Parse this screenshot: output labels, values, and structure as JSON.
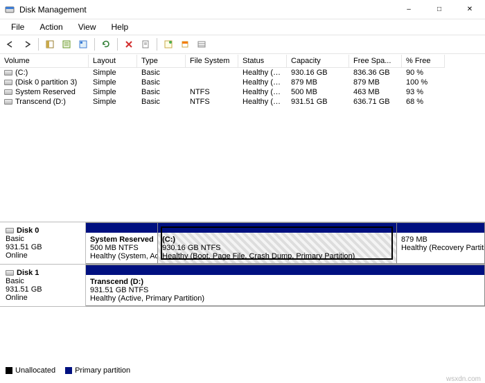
{
  "window": {
    "title": "Disk Management"
  },
  "menu": {
    "file": "File",
    "action": "Action",
    "view": "View",
    "help": "Help"
  },
  "columns": {
    "volume": "Volume",
    "layout": "Layout",
    "type": "Type",
    "filesystem": "File System",
    "status": "Status",
    "capacity": "Capacity",
    "freespace": "Free Spa...",
    "pctfree": "% Free"
  },
  "volumes": [
    {
      "name": "(C:)",
      "layout": "Simple",
      "type": "Basic",
      "fs": "",
      "status": "Healthy (B...",
      "capacity": "930.16 GB",
      "free": "836.36 GB",
      "pct": "90 %"
    },
    {
      "name": "(Disk 0 partition 3)",
      "layout": "Simple",
      "type": "Basic",
      "fs": "",
      "status": "Healthy (R...",
      "capacity": "879 MB",
      "free": "879 MB",
      "pct": "100 %"
    },
    {
      "name": "System Reserved",
      "layout": "Simple",
      "type": "Basic",
      "fs": "NTFS",
      "status": "Healthy (S...",
      "capacity": "500 MB",
      "free": "463 MB",
      "pct": "93 %"
    },
    {
      "name": "Transcend (D:)",
      "layout": "Simple",
      "type": "Basic",
      "fs": "NTFS",
      "status": "Healthy (A...",
      "capacity": "931.51 GB",
      "free": "636.71 GB",
      "pct": "68 %"
    }
  ],
  "disks": [
    {
      "name": "Disk 0",
      "type": "Basic",
      "size": "931.51 GB",
      "state": "Online",
      "parts": [
        {
          "title": "System Reserved",
          "line2": "500 MB NTFS",
          "line3": "Healthy (System, Active,",
          "flex": "18",
          "sel": false
        },
        {
          "title": "(C:)",
          "line2": "930.16 GB NTFS",
          "line3": "Healthy (Boot, Page File, Crash Dump, Primary Partition)",
          "flex": "60",
          "sel": true
        },
        {
          "title": "",
          "line2": "879 MB",
          "line3": "Healthy (Recovery Partition",
          "flex": "22",
          "sel": false
        }
      ]
    },
    {
      "name": "Disk 1",
      "type": "Basic",
      "size": "931.51 GB",
      "state": "Online",
      "parts": [
        {
          "title": "Transcend  (D:)",
          "line2": "931.51 GB NTFS",
          "line3": "Healthy (Active, Primary Partition)",
          "flex": "100",
          "sel": false
        }
      ]
    }
  ],
  "legend": {
    "unallocated": "Unallocated",
    "primary": "Primary partition"
  },
  "watermark": "wsxdn.com"
}
